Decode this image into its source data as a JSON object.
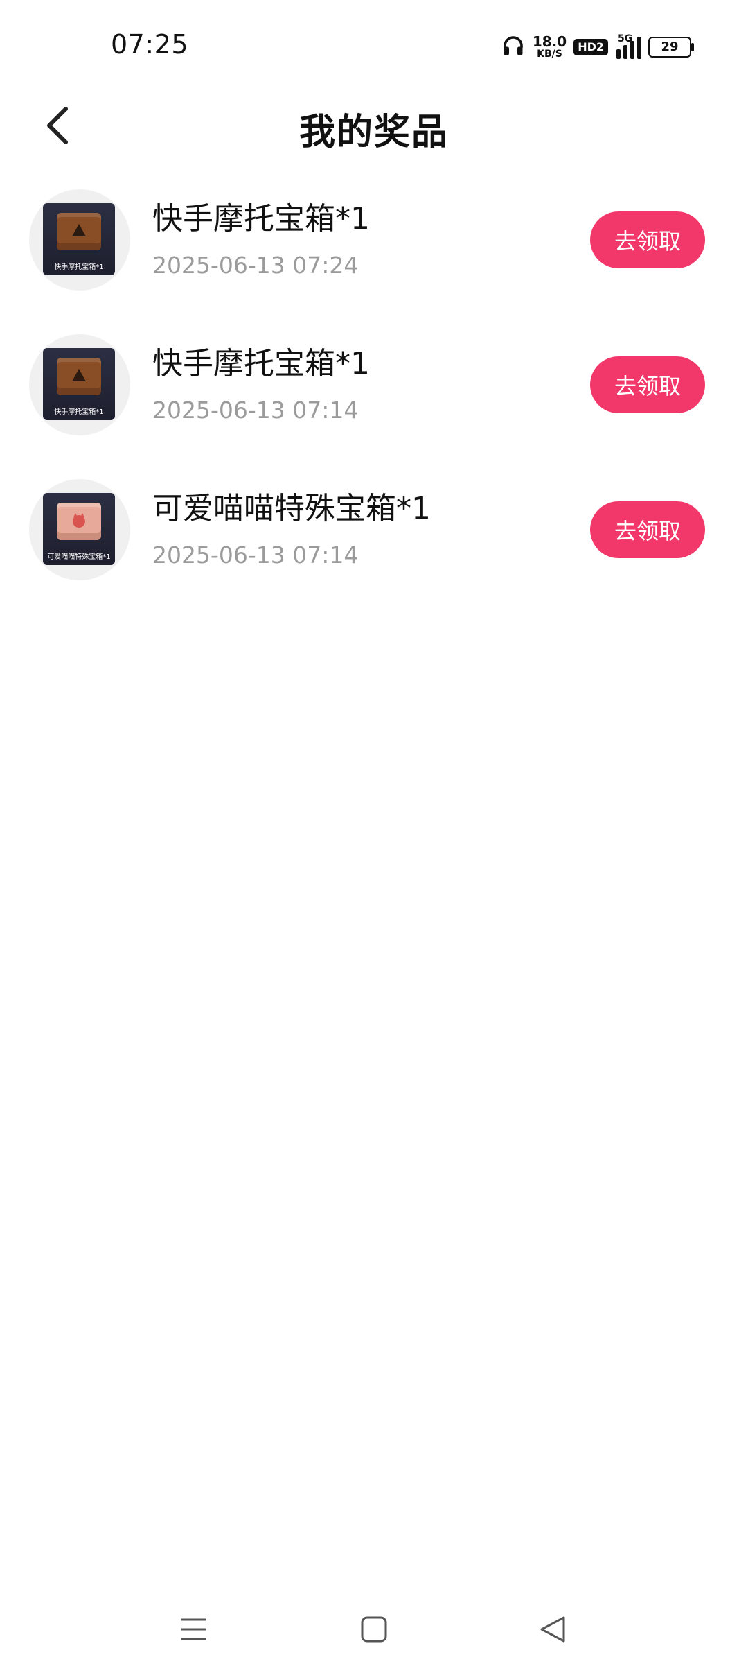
{
  "status_bar": {
    "time": "07:25",
    "net_speed_value": "18.0",
    "net_speed_unit": "KB/S",
    "hd_label": "HD2",
    "network_type": "5G",
    "battery_level": "29",
    "icons": [
      "headphones-icon",
      "hd-icon",
      "signal-icon",
      "battery-icon"
    ]
  },
  "header": {
    "title": "我的奖品",
    "back_icon": "chevron-left-icon"
  },
  "prizes": [
    {
      "name": "快手摩托宝箱*1",
      "time": "2025-06-13 07:24",
      "thumb_caption": "快手摩托宝箱*1",
      "button": "去领取",
      "chest_color": "#8a4e26"
    },
    {
      "name": "快手摩托宝箱*1",
      "time": "2025-06-13 07:14",
      "thumb_caption": "快手摩托宝箱*1",
      "button": "去领取",
      "chest_color": "#8a4e26"
    },
    {
      "name": "可爱喵喵特殊宝箱*1",
      "time": "2025-06-13 07:14",
      "thumb_caption": "可爱喵喵特殊宝箱*1",
      "button": "去领取",
      "chest_color": "#e7aa9a"
    }
  ],
  "nav_bar": {
    "icons": [
      "menu-icon",
      "home-square-icon",
      "back-triangle-icon"
    ]
  },
  "colors": {
    "accent": "#f2386a",
    "secondary_text": "#9b9b9b",
    "thumb_circle": "#f0f0f0"
  }
}
